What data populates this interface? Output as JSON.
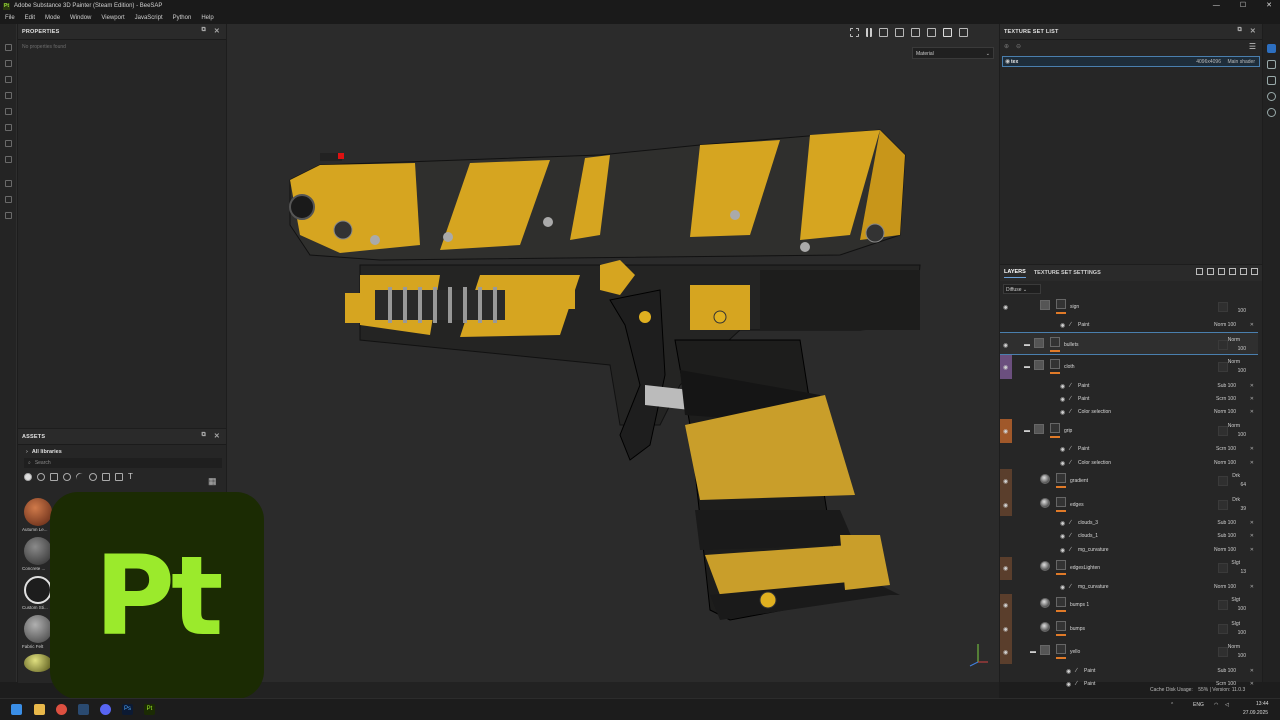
{
  "app": {
    "title": "Adobe Substance 3D Painter (Steam Edition) - BeeSAP",
    "icon_label": "Pt",
    "window_controls": [
      "—",
      "☐",
      "✕"
    ]
  },
  "menu": [
    "File",
    "Edit",
    "Mode",
    "Window",
    "Viewport",
    "JavaScript",
    "Python",
    "Help"
  ],
  "properties": {
    "title": "PROPERTIES",
    "empty_text": "No properties found"
  },
  "assets": {
    "title": "ASSETS",
    "library": "All libraries",
    "search_placeholder": "Search",
    "items": [
      {
        "name": "Autumn Le...",
        "color": "#8a3a22"
      },
      {
        "name": "Concrete ...",
        "color": "#5a5a5a"
      },
      {
        "name": "Custom Sti...",
        "color": "#d9d9d9"
      },
      {
        "name": "Fabric Felt",
        "color": "#7a7a7a"
      },
      {
        "name": "",
        "color": "#9a9a3a"
      }
    ]
  },
  "logo_text": "Pt",
  "viewport": {
    "material_select": "Material"
  },
  "texture_set_list": {
    "title": "TEXTURE SET LIST",
    "sets": [
      {
        "name": "tex",
        "resolution": "4096x4096",
        "shader": "Main shader"
      }
    ]
  },
  "layers": {
    "tabs": [
      "LAYERS",
      "TEXTURE SET SETTINGS"
    ],
    "channel": "Diffuse",
    "rows": [
      {
        "name": "sign",
        "blend": "",
        "opacity": "100",
        "level": 1,
        "kind": "partial"
      },
      {
        "name": "Paint",
        "blend": "Norm",
        "opacity": "100",
        "level": 2,
        "kind": "effect"
      },
      {
        "name": "bullets",
        "blend": "Norm",
        "opacity": "100",
        "level": 0,
        "kind": "folder",
        "selected": true
      },
      {
        "name": "cloth",
        "blend": "Norm",
        "opacity": "100",
        "level": 0,
        "kind": "folder",
        "group": "purple"
      },
      {
        "name": "Paint",
        "blend": "Sub",
        "opacity": "100",
        "level": 2,
        "kind": "effect"
      },
      {
        "name": "Paint",
        "blend": "Scrn",
        "opacity": "100",
        "level": 2,
        "kind": "effect"
      },
      {
        "name": "Color selection",
        "blend": "Norm",
        "opacity": "100",
        "level": 2,
        "kind": "effect"
      },
      {
        "name": "grip",
        "blend": "Norm",
        "opacity": "100",
        "level": 0,
        "kind": "folder",
        "group": "orange"
      },
      {
        "name": "Paint",
        "blend": "Scrn",
        "opacity": "100",
        "level": 2,
        "kind": "effect"
      },
      {
        "name": "Color selection",
        "blend": "Norm",
        "opacity": "100",
        "level": 2,
        "kind": "effect"
      },
      {
        "name": "gradient",
        "blend": "Drk",
        "opacity": "64",
        "level": 1,
        "kind": "fill"
      },
      {
        "name": "edges",
        "blend": "Drk",
        "opacity": "39",
        "level": 1,
        "kind": "fill"
      },
      {
        "name": "clouds_3",
        "blend": "Sub",
        "opacity": "100",
        "level": 2,
        "kind": "effect"
      },
      {
        "name": "clouds_1",
        "blend": "Sub",
        "opacity": "100",
        "level": 2,
        "kind": "effect"
      },
      {
        "name": "mg_curvature",
        "blend": "Norm",
        "opacity": "100",
        "level": 2,
        "kind": "effect"
      },
      {
        "name": "edgesLighten",
        "blend": "Slgt",
        "opacity": "13",
        "level": 1,
        "kind": "fill"
      },
      {
        "name": "mg_curvature",
        "blend": "Norm",
        "opacity": "100",
        "level": 2,
        "kind": "effect"
      },
      {
        "name": "bumps 1",
        "blend": "Slgt",
        "opacity": "100",
        "level": 1,
        "kind": "fill"
      },
      {
        "name": "bumps",
        "blend": "Slgt",
        "opacity": "100",
        "level": 1,
        "kind": "fill"
      },
      {
        "name": "yello",
        "blend": "Norm",
        "opacity": "100",
        "level": 1,
        "kind": "folder"
      },
      {
        "name": "Paint",
        "blend": "Sub",
        "opacity": "100",
        "level": 3,
        "kind": "effect"
      },
      {
        "name": "Paint",
        "blend": "Scrn",
        "opacity": "100",
        "level": 3,
        "kind": "effect"
      }
    ]
  },
  "status": {
    "cache": "Cache Disk Usage:",
    "usage": "55% | Version: 11.0.3 (OpenGL)"
  },
  "taskbar": {
    "lang": "ENG",
    "time": "13:44",
    "date": "27.09.2025"
  },
  "colors": {
    "accent": "#4a7fae",
    "orange": "#e07a28",
    "group_purple": "#6b4f7e",
    "group_orange": "#a0582a",
    "group_brown": "#5a3e2c",
    "logo_bg": "#1b2b03",
    "logo_fg": "#9bea2c"
  }
}
